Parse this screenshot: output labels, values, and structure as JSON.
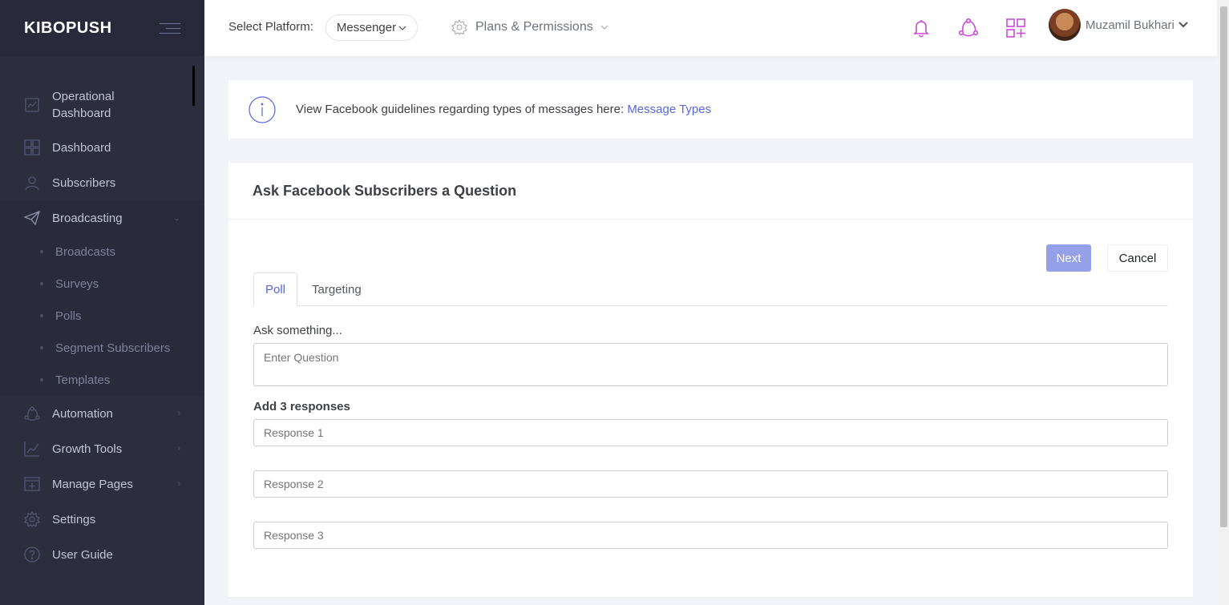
{
  "brand": "KIBOPUSH",
  "sidebar": {
    "items": [
      {
        "label_1": "Operational",
        "label_2": "Dashboard",
        "icon": "chart-board-icon"
      },
      {
        "label": "Dashboard",
        "icon": "grid-icon"
      },
      {
        "label": "Subscribers",
        "icon": "user-icon"
      },
      {
        "label": "Broadcasting",
        "icon": "paper-plane-icon"
      },
      {
        "label": "Automation",
        "icon": "network-icon"
      },
      {
        "label": "Growth Tools",
        "icon": "line-chart-icon"
      },
      {
        "label": "Manage Pages",
        "icon": "add-page-icon"
      },
      {
        "label": "Settings",
        "icon": "gear-icon"
      },
      {
        "label": "User Guide",
        "icon": "question-icon"
      }
    ],
    "broadcasting_sub": [
      "Broadcasts",
      "Surveys",
      "Polls",
      "Segment Subscribers",
      "Templates"
    ]
  },
  "topbar": {
    "select_platform_label": "Select Platform:",
    "platform_value": "Messenger",
    "plans_label": "Plans & Permissions",
    "user_name": "Muzamil Bukhari"
  },
  "info": {
    "text": "View Facebook guidelines regarding types of messages here: ",
    "link": "Message Types"
  },
  "portlet": {
    "title": "Ask Facebook Subscribers a Question",
    "next_label": "Next",
    "cancel_label": "Cancel",
    "tabs": [
      "Poll",
      "Targeting"
    ],
    "ask_label": "Ask something...",
    "question_placeholder": "Enter Question",
    "responses_label": "Add 3 responses",
    "responses": [
      "Response 1",
      "Response 2",
      "Response 3"
    ]
  },
  "colors": {
    "sidebar_bg": "#2c2e3e",
    "accent": "#5867dd",
    "notification_icon": "#c94bd6",
    "next_button": "#94a1e8"
  }
}
